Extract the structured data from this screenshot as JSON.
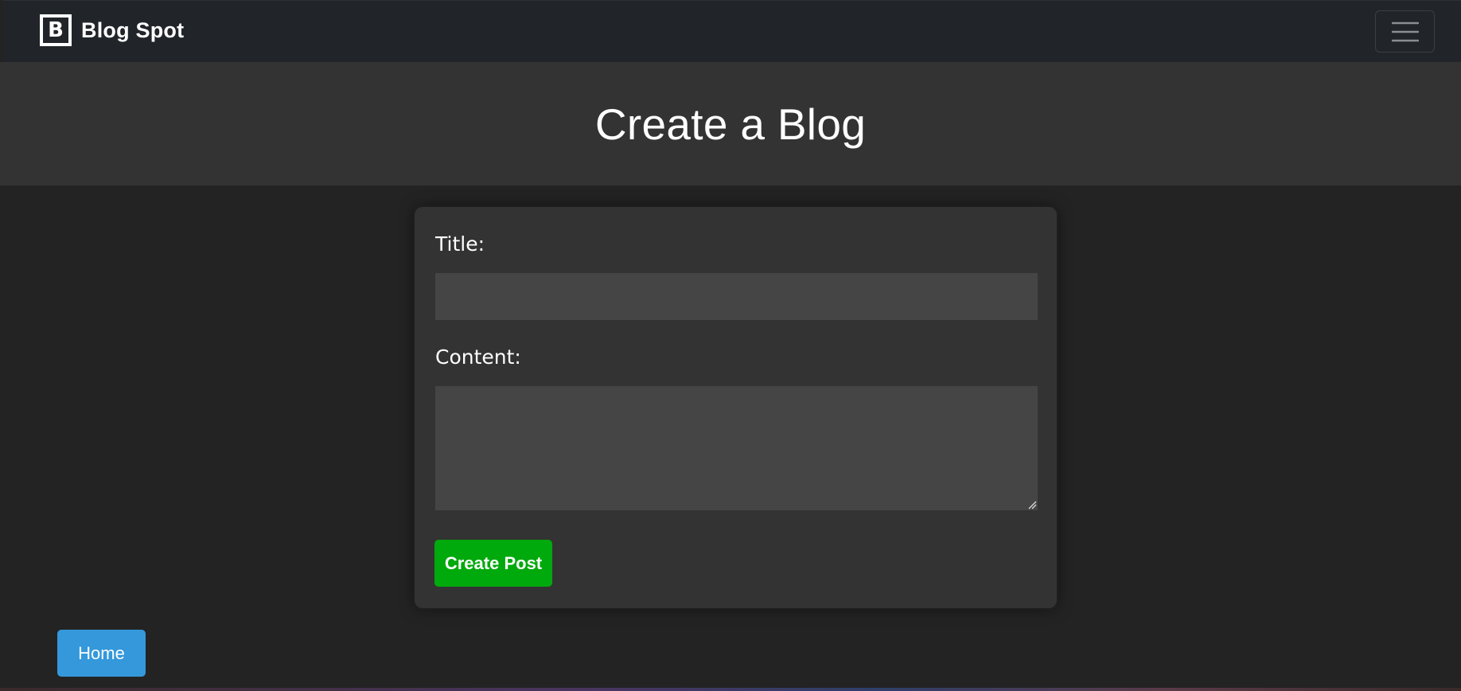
{
  "navbar": {
    "brand_logo_letter": "B",
    "brand_name": "Blog Spot",
    "menu_icon": "hamburger-menu-icon"
  },
  "header": {
    "title": "Create a Blog"
  },
  "form": {
    "title_label": "Title:",
    "title_value": "",
    "content_label": "Content:",
    "content_value": "",
    "submit_label": "Create Post"
  },
  "footer": {
    "home_label": "Home"
  },
  "colors": {
    "navbar_bg": "#212529",
    "page_bg": "#232323",
    "header_bg": "#333333",
    "card_bg": "#333333",
    "input_bg": "#454545",
    "submit_button": "#00a90c",
    "home_button": "#3498db"
  }
}
